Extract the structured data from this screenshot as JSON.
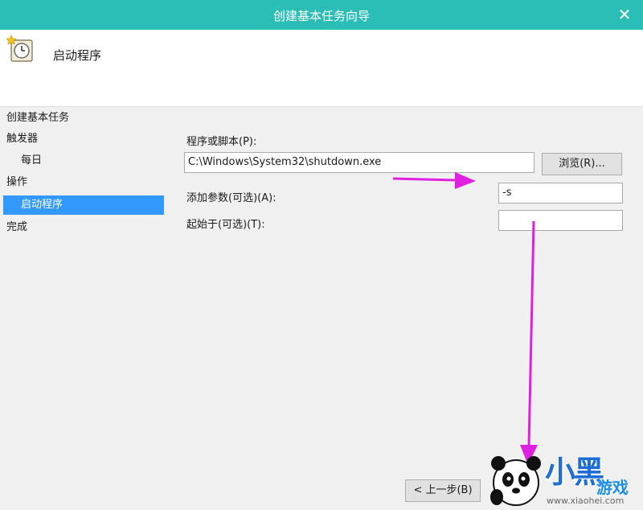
{
  "window": {
    "title": "创建基本任务向导",
    "close_glyph": "✕"
  },
  "header": {
    "heading": "启动程序"
  },
  "nav": {
    "items": [
      {
        "label": "创建基本任务"
      },
      {
        "label": "触发器"
      },
      {
        "label": "每日"
      },
      {
        "label": "操作"
      },
      {
        "label": "启动程序"
      },
      {
        "label": "完成"
      }
    ]
  },
  "form": {
    "program_label": "程序或脚本(P):",
    "program_value": "C:\\Windows\\System32\\shutdown.exe",
    "browse_label": "浏览(R)...",
    "args_label": "添加参数(可选)(A):",
    "args_value": "-s",
    "startin_label": "起始于(可选)(T):",
    "startin_value": ""
  },
  "footer": {
    "back_label": "< 上一步(B)"
  },
  "watermark": {
    "brand": "小黑",
    "brand2": "游戏",
    "site": "www.xiaohei.com"
  },
  "colors": {
    "titlebar": "#2bbeb6",
    "selection": "#3399ff",
    "arrow": "#e020e0"
  }
}
